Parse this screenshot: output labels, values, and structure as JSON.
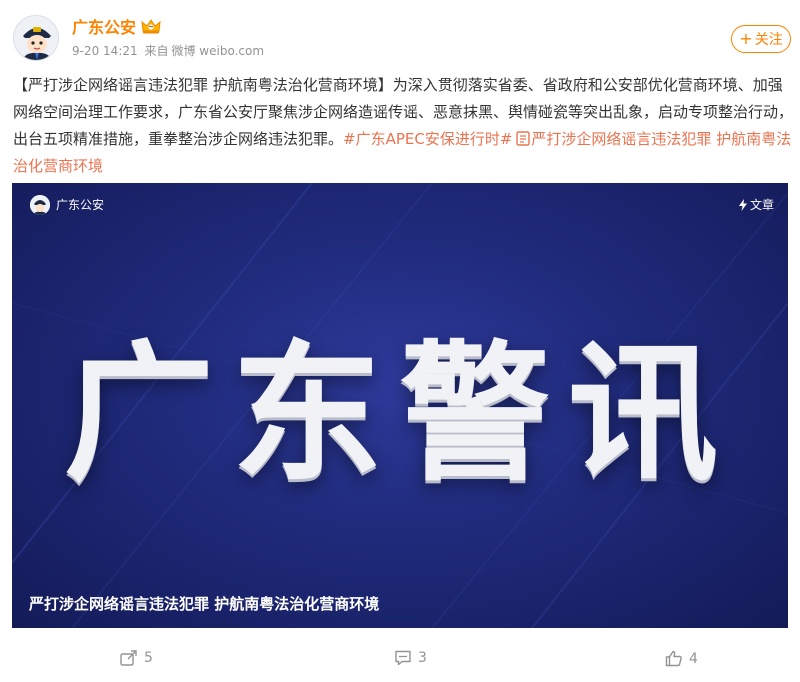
{
  "author": {
    "name": "广东公安",
    "time": "9-20 14:21",
    "source_prefix": "来自",
    "source": "微博 weibo.com"
  },
  "follow": {
    "label": "关注"
  },
  "post": {
    "title": "【严打涉企网络谣言违法犯罪 护航南粤法治化营商环境】",
    "body": "为深入贯彻落实省委、省政府和公安部优化营商环境、加强网络空间治理工作要求，广东省公安厅聚焦涉企网络造谣传谣、恶意抹黑、舆情碰瓷等突出乱象，启动专项整治行动，出台五项精准措施，重拳整治涉企网络违法犯罪。",
    "hashtag": "#广东APEC安保进行时#",
    "article_link": "严打涉企网络谣言违法犯罪 护航南粤法治化营商环境"
  },
  "video": {
    "author": "广东公安",
    "article_label": "文章",
    "big_title": "广东警讯",
    "caption": "严打涉企网络谣言违法犯罪 护航南粤法治化营商环境"
  },
  "actions": {
    "share_count": "5",
    "comment_count": "3",
    "like_count": "4"
  },
  "colors": {
    "accent": "#ff8200",
    "link": "#eb7350",
    "video_bg": "#1f2a7a"
  }
}
